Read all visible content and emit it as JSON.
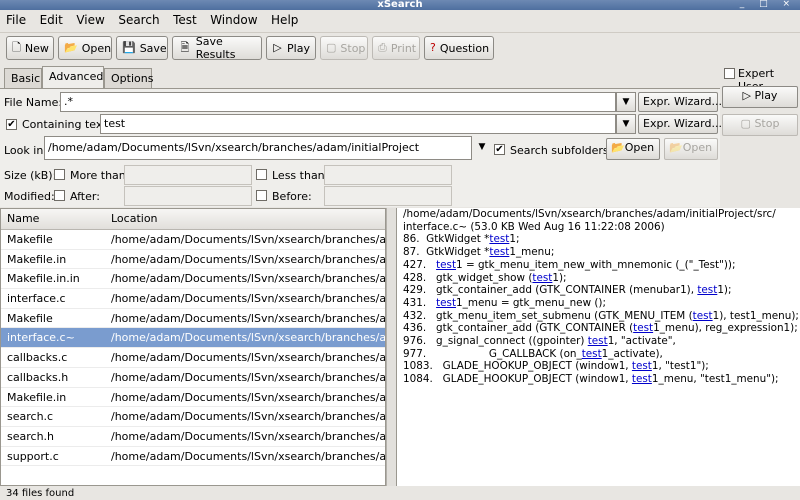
{
  "window": {
    "title": "xSearch",
    "controls": "_ □ ×"
  },
  "menu": [
    "File",
    "Edit",
    "View",
    "Search",
    "Test",
    "Window",
    "Help"
  ],
  "toolbar": {
    "new": "New",
    "open": "Open",
    "save": "Save",
    "save_results": "Save Results",
    "play": "Play",
    "stop": "Stop",
    "print": "Print",
    "question": "Question"
  },
  "tabs": {
    "basic": "Basic",
    "advanced": "Advanced",
    "options": "Options"
  },
  "form": {
    "file_name_label": "File Name:",
    "file_name_value": ".*",
    "expr_wizard": "Expr. Wizard...",
    "containing_text_label": "Containing text:",
    "containing_text_value": "test",
    "look_in_label": "Look in:",
    "look_in_value": "/home/adam/Documents/lSvn/xsearch/branches/adam/initialProject",
    "search_subfolders": "Search subfolders",
    "open": "Open",
    "open_disabled": "Open",
    "size_label": "Size (kB):",
    "more_than": "More than:",
    "less_than": "Less than:",
    "modified_label": "Modified:",
    "after": "After:",
    "before": "Before:"
  },
  "right_panel": {
    "expert_user": "Expert User",
    "play": "Play",
    "stop": "Stop"
  },
  "list": {
    "col_name": "Name",
    "col_location": "Location",
    "rows": [
      {
        "name": "Makefile",
        "location": "/home/adam/Documents/lSvn/xsearch/branches/adam/"
      },
      {
        "name": "Makefile.in",
        "location": "/home/adam/Documents/lSvn/xsearch/branches/adam/"
      },
      {
        "name": "Makefile.in.in",
        "location": "/home/adam/Documents/lSvn/xsearch/branches/adam/"
      },
      {
        "name": "interface.c",
        "location": "/home/adam/Documents/lSvn/xsearch/branches/adam/"
      },
      {
        "name": "Makefile",
        "location": "/home/adam/Documents/lSvn/xsearch/branches/adam/"
      },
      {
        "name": "interface.c~",
        "location": "/home/adam/Documents/lSvn/xsearch/branches/adam/"
      },
      {
        "name": "callbacks.c",
        "location": "/home/adam/Documents/lSvn/xsearch/branches/adam/"
      },
      {
        "name": "callbacks.h",
        "location": "/home/adam/Documents/lSvn/xsearch/branches/adam/"
      },
      {
        "name": "Makefile.in",
        "location": "/home/adam/Documents/lSvn/xsearch/branches/adam/"
      },
      {
        "name": "search.c",
        "location": "/home/adam/Documents/lSvn/xsearch/branches/adam/"
      },
      {
        "name": "search.h",
        "location": "/home/adam/Documents/lSvn/xsearch/branches/adam/"
      },
      {
        "name": "support.c",
        "location": "/home/adam/Documents/lSvn/xsearch/branches/adam/"
      }
    ]
  },
  "results": {
    "path_line1": "/home/adam/Documents/lSvn/xsearch/branches/adam/initialProject/src/",
    "path_line2": "interface.c~ (53.0 KB Wed Aug 16 11:22:08 2006)",
    "lines": [
      {
        "n": "86.",
        "pre": "  GtkWidget *",
        "hit": "test",
        "post": "1;"
      },
      {
        "n": "87.",
        "pre": "  GtkWidget *",
        "hit": "test",
        "post": "1_menu;"
      },
      {
        "n": "427.",
        "pre": "   ",
        "hit": "test",
        "post": "1 = gtk_menu_item_new_with_mnemonic (_(\"_Test\"));"
      },
      {
        "n": "428.",
        "pre": "   gtk_widget_show (",
        "hit": "test",
        "post": "1);"
      },
      {
        "n": "429.",
        "pre": "   gtk_container_add (GTK_CONTAINER (menubar1), ",
        "hit": "test",
        "post": "1);"
      },
      {
        "n": "431.",
        "pre": "   ",
        "hit": "test",
        "post": "1_menu = gtk_menu_new ();"
      },
      {
        "n": "432.",
        "pre": "   gtk_menu_item_set_submenu (GTK_MENU_ITEM (",
        "hit": "test",
        "post": "1), test1_menu);"
      },
      {
        "n": "436.",
        "pre": "   gtk_container_add (GTK_CONTAINER (",
        "hit": "test",
        "post": "1_menu), reg_expression1);"
      },
      {
        "n": "976.",
        "pre": "   g_signal_connect ((gpointer) ",
        "hit": "test",
        "post": "1, \"activate\","
      },
      {
        "n": "977.",
        "pre": "                   G_CALLBACK (on_",
        "hit": "test",
        "post": "1_activate),"
      },
      {
        "n": "1083.",
        "pre": "   GLADE_HOOKUP_OBJECT (window1, ",
        "hit": "test",
        "post": "1, \"test1\");"
      },
      {
        "n": "1084.",
        "pre": "   GLADE_HOOKUP_OBJECT (window1, ",
        "hit": "test",
        "post": "1_menu, \"test1_menu\");"
      }
    ]
  },
  "status": "34 files found"
}
